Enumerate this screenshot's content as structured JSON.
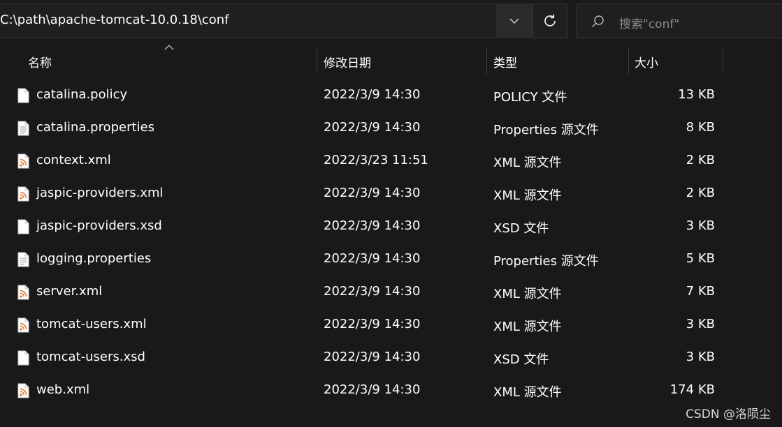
{
  "address_bar": {
    "path": "C:\\path\\apache-tomcat-10.0.18\\conf"
  },
  "search": {
    "placeholder": "搜索\"conf\""
  },
  "columns": {
    "name": "名称",
    "date": "修改日期",
    "type": "类型",
    "size": "大小"
  },
  "files": [
    {
      "name": "catalina.policy",
      "date": "2022/3/9 14:30",
      "type": "POLICY 文件",
      "size": "13 KB",
      "icon": "blank-file-icon"
    },
    {
      "name": "catalina.properties",
      "date": "2022/3/9 14:30",
      "type": "Properties 源文件",
      "size": "8 KB",
      "icon": "text-file-icon"
    },
    {
      "name": "context.xml",
      "date": "2022/3/23 11:51",
      "type": "XML 源文件",
      "size": "2 KB",
      "icon": "xml-file-icon"
    },
    {
      "name": "jaspic-providers.xml",
      "date": "2022/3/9 14:30",
      "type": "XML 源文件",
      "size": "2 KB",
      "icon": "xml-file-icon"
    },
    {
      "name": "jaspic-providers.xsd",
      "date": "2022/3/9 14:30",
      "type": "XSD 文件",
      "size": "3 KB",
      "icon": "blank-file-icon"
    },
    {
      "name": "logging.properties",
      "date": "2022/3/9 14:30",
      "type": "Properties 源文件",
      "size": "5 KB",
      "icon": "text-file-icon"
    },
    {
      "name": "server.xml",
      "date": "2022/3/9 14:30",
      "type": "XML 源文件",
      "size": "7 KB",
      "icon": "xml-file-icon"
    },
    {
      "name": "tomcat-users.xml",
      "date": "2022/3/9 14:30",
      "type": "XML 源文件",
      "size": "3 KB",
      "icon": "xml-file-icon"
    },
    {
      "name": "tomcat-users.xsd",
      "date": "2022/3/9 14:30",
      "type": "XSD 文件",
      "size": "3 KB",
      "icon": "blank-file-icon"
    },
    {
      "name": "web.xml",
      "date": "2022/3/9 14:30",
      "type": "XML 源文件",
      "size": "174 KB",
      "icon": "xml-file-icon"
    }
  ],
  "watermark": "CSDN @洛陨尘",
  "colors": {
    "background": "#191919",
    "text": "#ffffff",
    "muted": "#8a8a8a",
    "border": "#3a3a3a",
    "xml_icon_accent": "#e07a2e"
  }
}
